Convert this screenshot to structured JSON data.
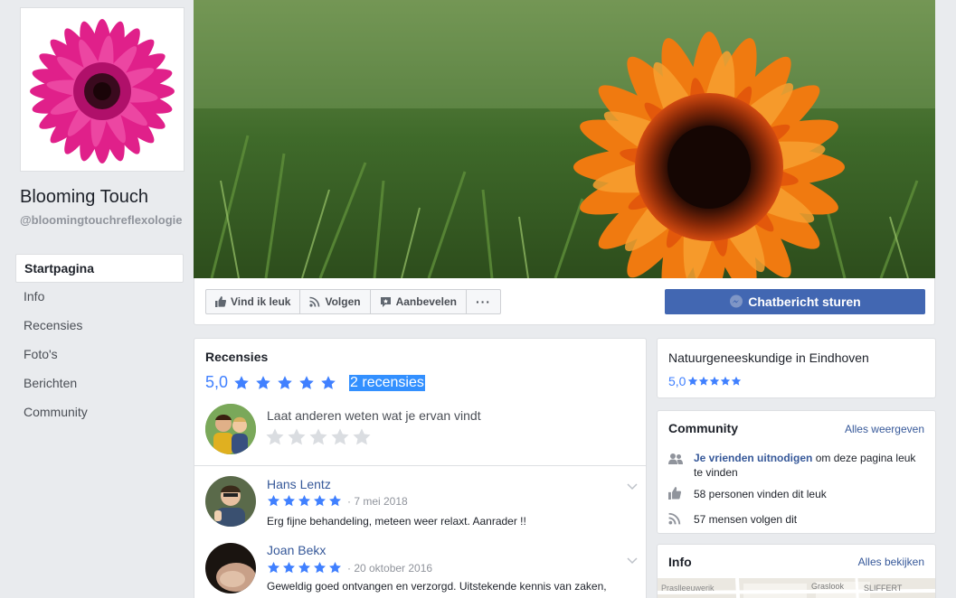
{
  "sidebar": {
    "page_name": "Blooming Touch",
    "page_handle": "@bloomingtouchreflexologie",
    "nav": [
      {
        "label": "Startpagina",
        "active": true
      },
      {
        "label": "Info"
      },
      {
        "label": "Recensies"
      },
      {
        "label": "Foto's"
      },
      {
        "label": "Berichten"
      },
      {
        "label": "Community"
      }
    ]
  },
  "actions": {
    "like": "Vind ik leuk",
    "follow": "Volgen",
    "recommend": "Aanbevelen",
    "more": "···",
    "message": "Chatbericht sturen"
  },
  "reviews": {
    "title": "Recensies",
    "rating": "5,0",
    "count_label": "2 recensies",
    "prompt": "Laat anderen weten wat je ervan vindt",
    "items": [
      {
        "name": "Hans Lentz",
        "date": "· 7 mei 2018",
        "stars": 5,
        "text": "Erg fijne behandeling, meteen weer relaxt. Aanrader !!"
      },
      {
        "name": "Joan Bekx",
        "date": "· 20 oktober 2016",
        "stars": 5,
        "text": "Geweldig goed ontvangen en verzorgd. Uitstekende kennis van zaken,"
      }
    ]
  },
  "about": {
    "category": "Natuurgeneeskundige in Eindhoven",
    "rating": "5,0"
  },
  "community": {
    "title": "Community",
    "see_all": "Alles weergeven",
    "invite_link": "Je vrienden uitnodigen",
    "invite_rest": " om deze pagina leuk te vinden",
    "likes": "58 personen vinden dit leuk",
    "follows": "57 mensen volgen dit"
  },
  "info": {
    "title": "Info",
    "see_all": "Alles bekijken",
    "map_label_1": "Graslook",
    "map_label_2": "SLIFFERT",
    "map_label_3": "Praslleeuwerik"
  },
  "colors": {
    "accent": "#4267b2",
    "star": "#4080ff",
    "link": "#365899"
  }
}
